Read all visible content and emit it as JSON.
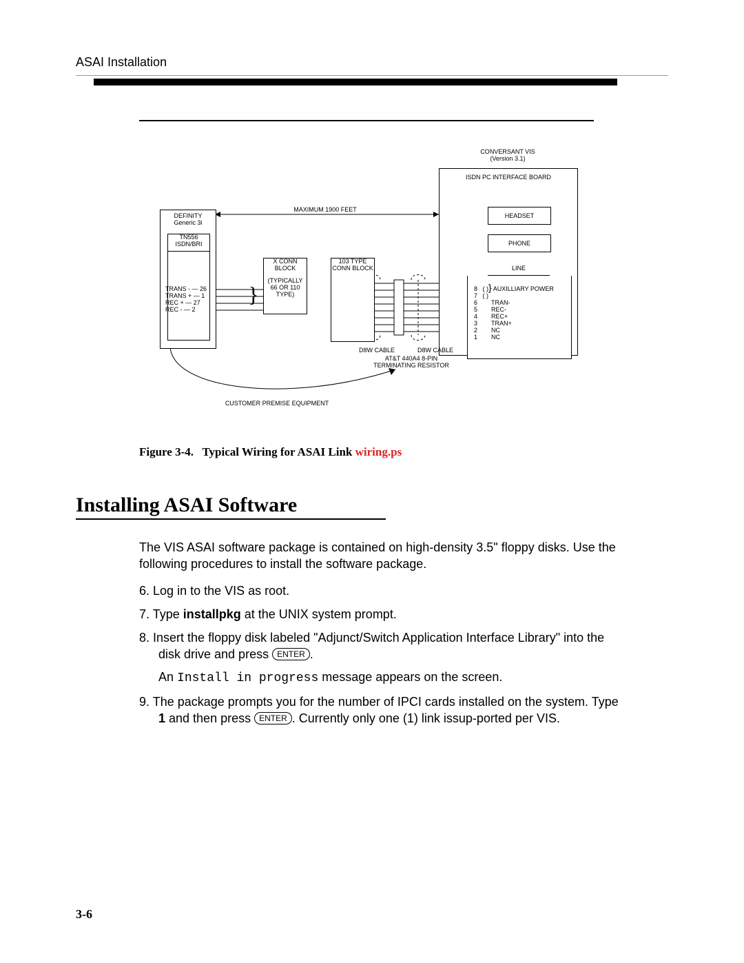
{
  "header": {
    "running": "ASAI Installation"
  },
  "figure": {
    "caption_label": "Figure 3-4.",
    "caption_text": "Typical Wiring for ASAI Link",
    "filename": "wiring.ps",
    "labels": {
      "conversant": "CONVERSANT  VIS",
      "version": "(Version 3.1)",
      "isdn_board": "ISDN PC INTERFACE BOARD",
      "headset": "HEADSET",
      "phone": "PHONE",
      "line": "LINE",
      "aux_power": "AUXILLIARY POWER",
      "definity": "DEFINITY",
      "definity_sub": "Generic 3i",
      "tn556": "TN556",
      "isdn_bri": "ISDN/BRI",
      "xconn": "X CONN",
      "block": "BLOCK",
      "typically": "TYPICALLY",
      "type66": "66 OR 110",
      "typeword": "TYPE",
      "conn103": "103 TYPE",
      "connblock": "CONN BLOCK",
      "max": "MAXIMUM 1900 FEET",
      "d8w": "D8W CABLE",
      "term": "AT&T 440A4 8-PIN",
      "term2": "TERMINATING RESISTOR",
      "cpe": "CUSTOMER PREMISE EQUIPMENT",
      "left_pins": {
        "trans_minus": "TRANS -",
        "trans_plus": "TRANS +",
        "rec_plus": "REC +",
        "rec_minus": "REC -",
        "n26": "26",
        "n1": "1",
        "n27": "27",
        "n2": "2"
      },
      "right_pins": {
        "p8": "8",
        "p7": "7",
        "p6": "6",
        "p5": "5",
        "p4": "4",
        "p3": "3",
        "p2": "2",
        "p1": "1",
        "sym": "( )",
        "tran_minus": "TRAN-",
        "rec_minus": "REC-",
        "rec_plus": "REC+",
        "tran_plus": "TRAN+",
        "nc": "NC"
      }
    }
  },
  "section": {
    "title": "Installing ASAI Software"
  },
  "body": {
    "intro": "The VIS ASAI software package is contained on high-density 3.5\" floppy disks. Use the following procedures to install the software package.",
    "steps": [
      {
        "n": "6.",
        "text": "Log in to the VIS as root."
      },
      {
        "n": "7.",
        "pre": "Type  ",
        "cmd": "installpkg",
        "post": "  at the UNIX system prompt."
      },
      {
        "n": "8.",
        "text_a": "Insert the floppy disk labeled \"Adjunct/Switch Application Interface Library\" into the disk drive and press  ",
        "key": "ENTER",
        "text_b": ".",
        "sub_a": "An ",
        "sub_mono": "Install in progress",
        "sub_b": "  message appears on the screen."
      },
      {
        "n": "9.",
        "text_a": "The package prompts you for the number of IPCI cards installed on the system.  Type  ",
        "cmd": "1",
        "text_b": "  and then press  ",
        "key": "ENTER",
        "text_c": ". Currently only one (1) link issup-ported per VIS."
      }
    ]
  },
  "page_number": "3-6"
}
